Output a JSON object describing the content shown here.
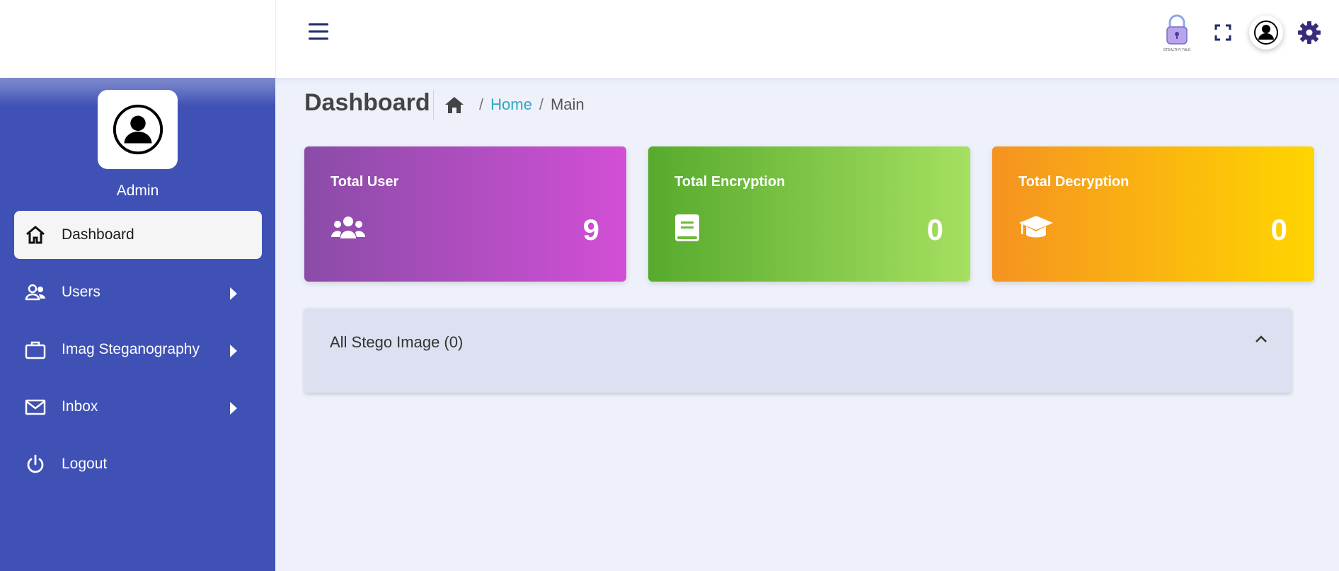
{
  "header": {
    "menu_icon": "hamburger-menu-icon",
    "logo_icon": "lock-logo-icon",
    "logo_text": "STEALTHY TALK",
    "fullscreen_icon": "fullscreen-icon",
    "avatar_icon": "user-avatar-icon",
    "settings_icon": "gear-icon"
  },
  "sidebar": {
    "profile": {
      "name": "Admin",
      "avatar_icon": "user-avatar-icon"
    },
    "items": [
      {
        "label": "Dashboard",
        "icon": "home-icon",
        "active": true,
        "has_submenu": false
      },
      {
        "label": "Users",
        "icon": "users-icon",
        "active": false,
        "has_submenu": true
      },
      {
        "label": "Imag Steganography",
        "icon": "briefcase-icon",
        "active": false,
        "has_submenu": true
      },
      {
        "label": "Inbox",
        "icon": "mail-icon",
        "active": false,
        "has_submenu": true
      },
      {
        "label": "Logout",
        "icon": "power-icon",
        "active": false,
        "has_submenu": false
      }
    ],
    "bg_color": "#3f51b5"
  },
  "main": {
    "page_title": "Dashboard",
    "breadcrumb": {
      "home_icon": "home-icon",
      "sep": "/",
      "home": "Home",
      "current": "Main"
    },
    "cards": [
      {
        "title": "Total User",
        "value": "9",
        "icon": "users-group-icon",
        "colors": [
          "#8a4ca7",
          "#d24fd6"
        ]
      },
      {
        "title": "Total Encryption",
        "value": "0",
        "icon": "book-icon",
        "colors": [
          "#57aa2d",
          "#a6e061"
        ]
      },
      {
        "title": "Total Decryption",
        "value": "0",
        "icon": "graduation-cap-icon",
        "colors": [
          "#f59321",
          "#ffd500"
        ]
      }
    ],
    "panel": {
      "title": "All Stego Image (0)",
      "toggle_icon": "chevron-up-icon"
    }
  }
}
